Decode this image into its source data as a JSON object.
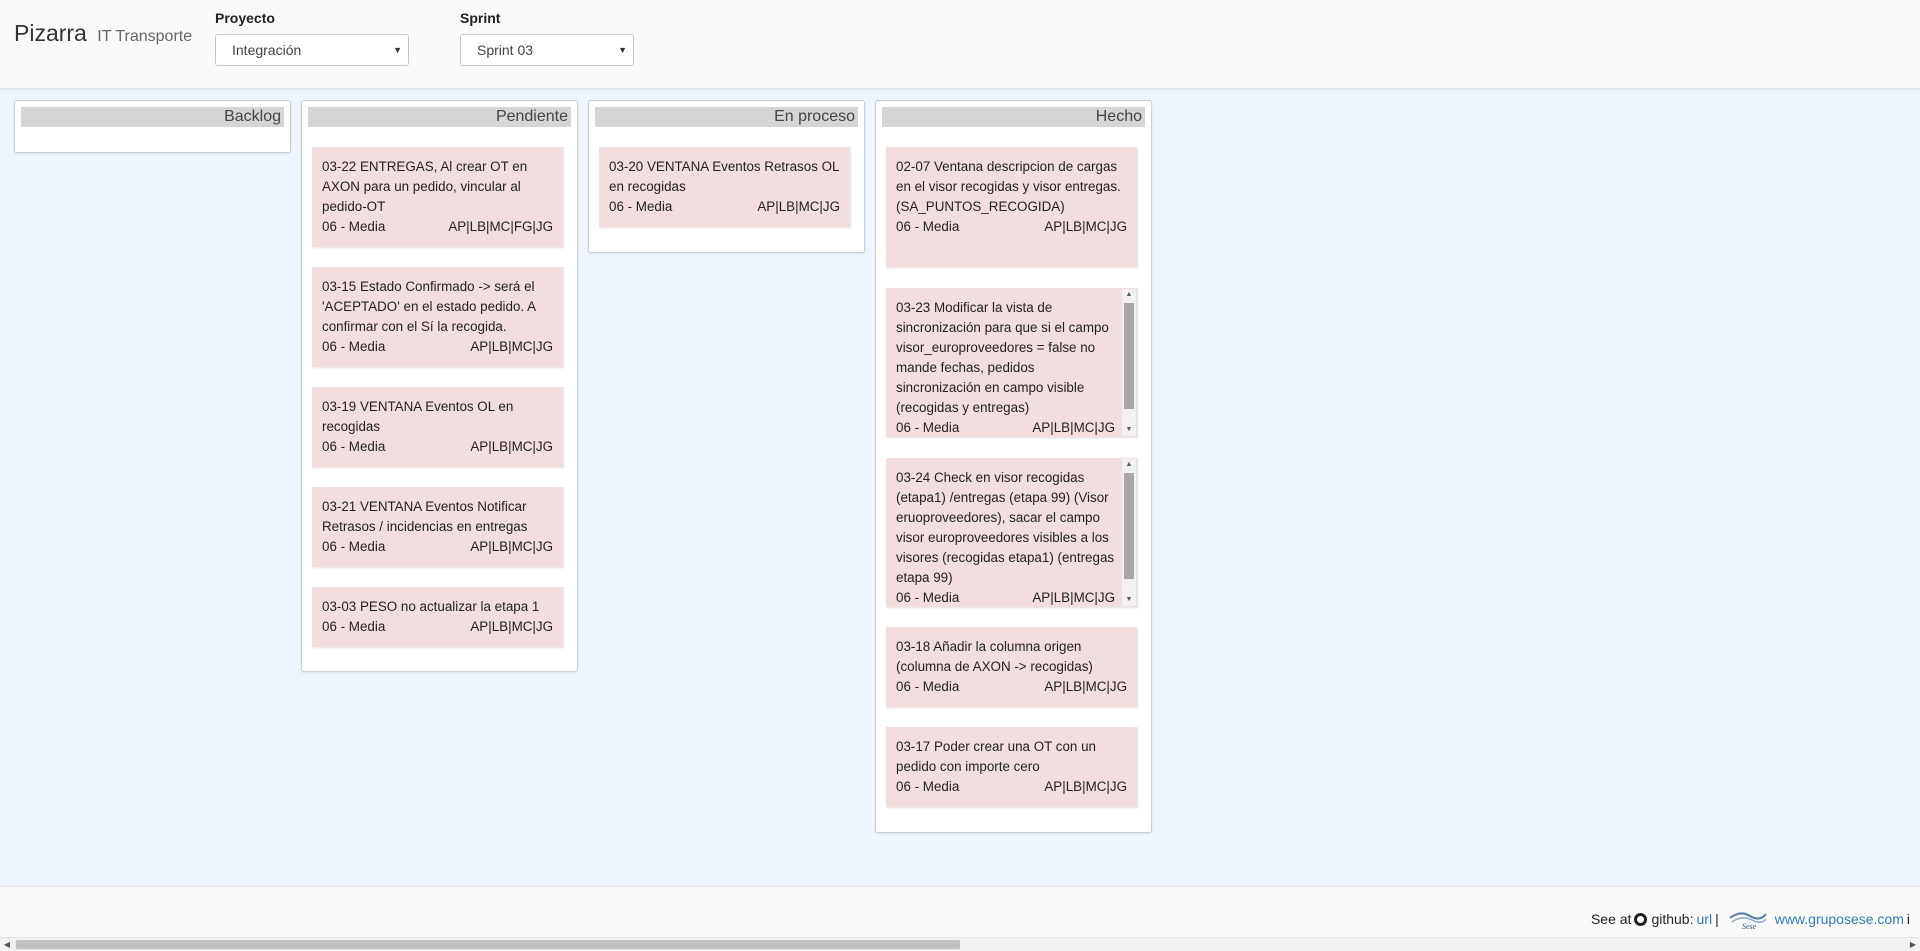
{
  "header": {
    "brand": "Pizarra",
    "brand_sub": "IT Transporte",
    "project_label": "Proyecto",
    "project_value": "Integración",
    "sprint_label": "Sprint",
    "sprint_value": "Sprint 03"
  },
  "columns": [
    {
      "title": "Backlog",
      "cards": []
    },
    {
      "title": "Pendiente",
      "cards": [
        {
          "text": "03-22 ENTREGAS, Al crear OT en AXON para un pedido, vincular al pedido-OT",
          "priority": "06 - Media",
          "assignees": "AP|LB|MC|FG|JG"
        },
        {
          "text": "03-15 Estado Confirmado -> será el 'ACEPTADO' en el estado pedido. A confirmar con el Sí la recogida.",
          "priority": "06 - Media",
          "assignees": "AP|LB|MC|JG"
        },
        {
          "text": "03-19 VENTANA Eventos OL en recogidas",
          "priority": "06 - Media",
          "assignees": "AP|LB|MC|JG"
        },
        {
          "text": "03-21 VENTANA Eventos Notificar Retrasos / incidencias en entregas",
          "priority": "06 - Media",
          "assignees": "AP|LB|MC|JG"
        },
        {
          "text": "03-03 PESO no actualizar la etapa 1",
          "priority": "06 - Media",
          "assignees": "AP|LB|MC|JG"
        }
      ]
    },
    {
      "title": "En proceso",
      "cards": [
        {
          "text": "03-20 VENTANA Eventos Retrasos OL en recogidas",
          "priority": "06 - Media",
          "assignees": "AP|LB|MC|JG"
        }
      ]
    },
    {
      "title": "Hecho",
      "cards": [
        {
          "text": "02-07 Ventana descripcion de cargas en el visor recogidas y visor entregas. (SA_PUNTOS_RECOGIDA)",
          "priority": "06 - Media",
          "assignees": "AP|LB|MC|JG"
        },
        {
          "text": "03-23 Modificar la vista de sincronización para que si el campo visor_europroveedores = false no mande fechas, pedidos sincronización en campo visible (recogidas y entregas)",
          "priority": "06 - Media",
          "assignees": "AP|LB|MC|JG"
        },
        {
          "text": "03-24 Check en visor recogidas (etapa1) /entregas (etapa 99) (Visor eruoproveedores), sacar el campo visor europroveedores visibles a los visores (recogidas etapa1) (entregas etapa 99)",
          "priority": "06 - Media",
          "assignees": "AP|LB|MC|JG"
        },
        {
          "text": "03-18 Añadir la columna origen (columna de AXON -> recogidas)",
          "priority": "06 - Media",
          "assignees": "AP|LB|MC|JG"
        },
        {
          "text": "03-17 Poder crear una OT con un pedido con importe cero",
          "priority": "06 - Media",
          "assignees": "AP|LB|MC|JG"
        }
      ]
    }
  ],
  "footer": {
    "see_at": "See at",
    "github": "github:",
    "url": "url",
    "separator": "|",
    "site": "www.gruposese.com",
    "trailing": "i"
  },
  "icons": {
    "select_caret": "caret-down-icon",
    "github": "github-icon",
    "logo": "sese-logo"
  },
  "colors": {
    "card_bg": "#f2dede",
    "column_title_bg": "#d5d5d5",
    "board_bg": "#eef5fd",
    "link": "#337ab7"
  }
}
